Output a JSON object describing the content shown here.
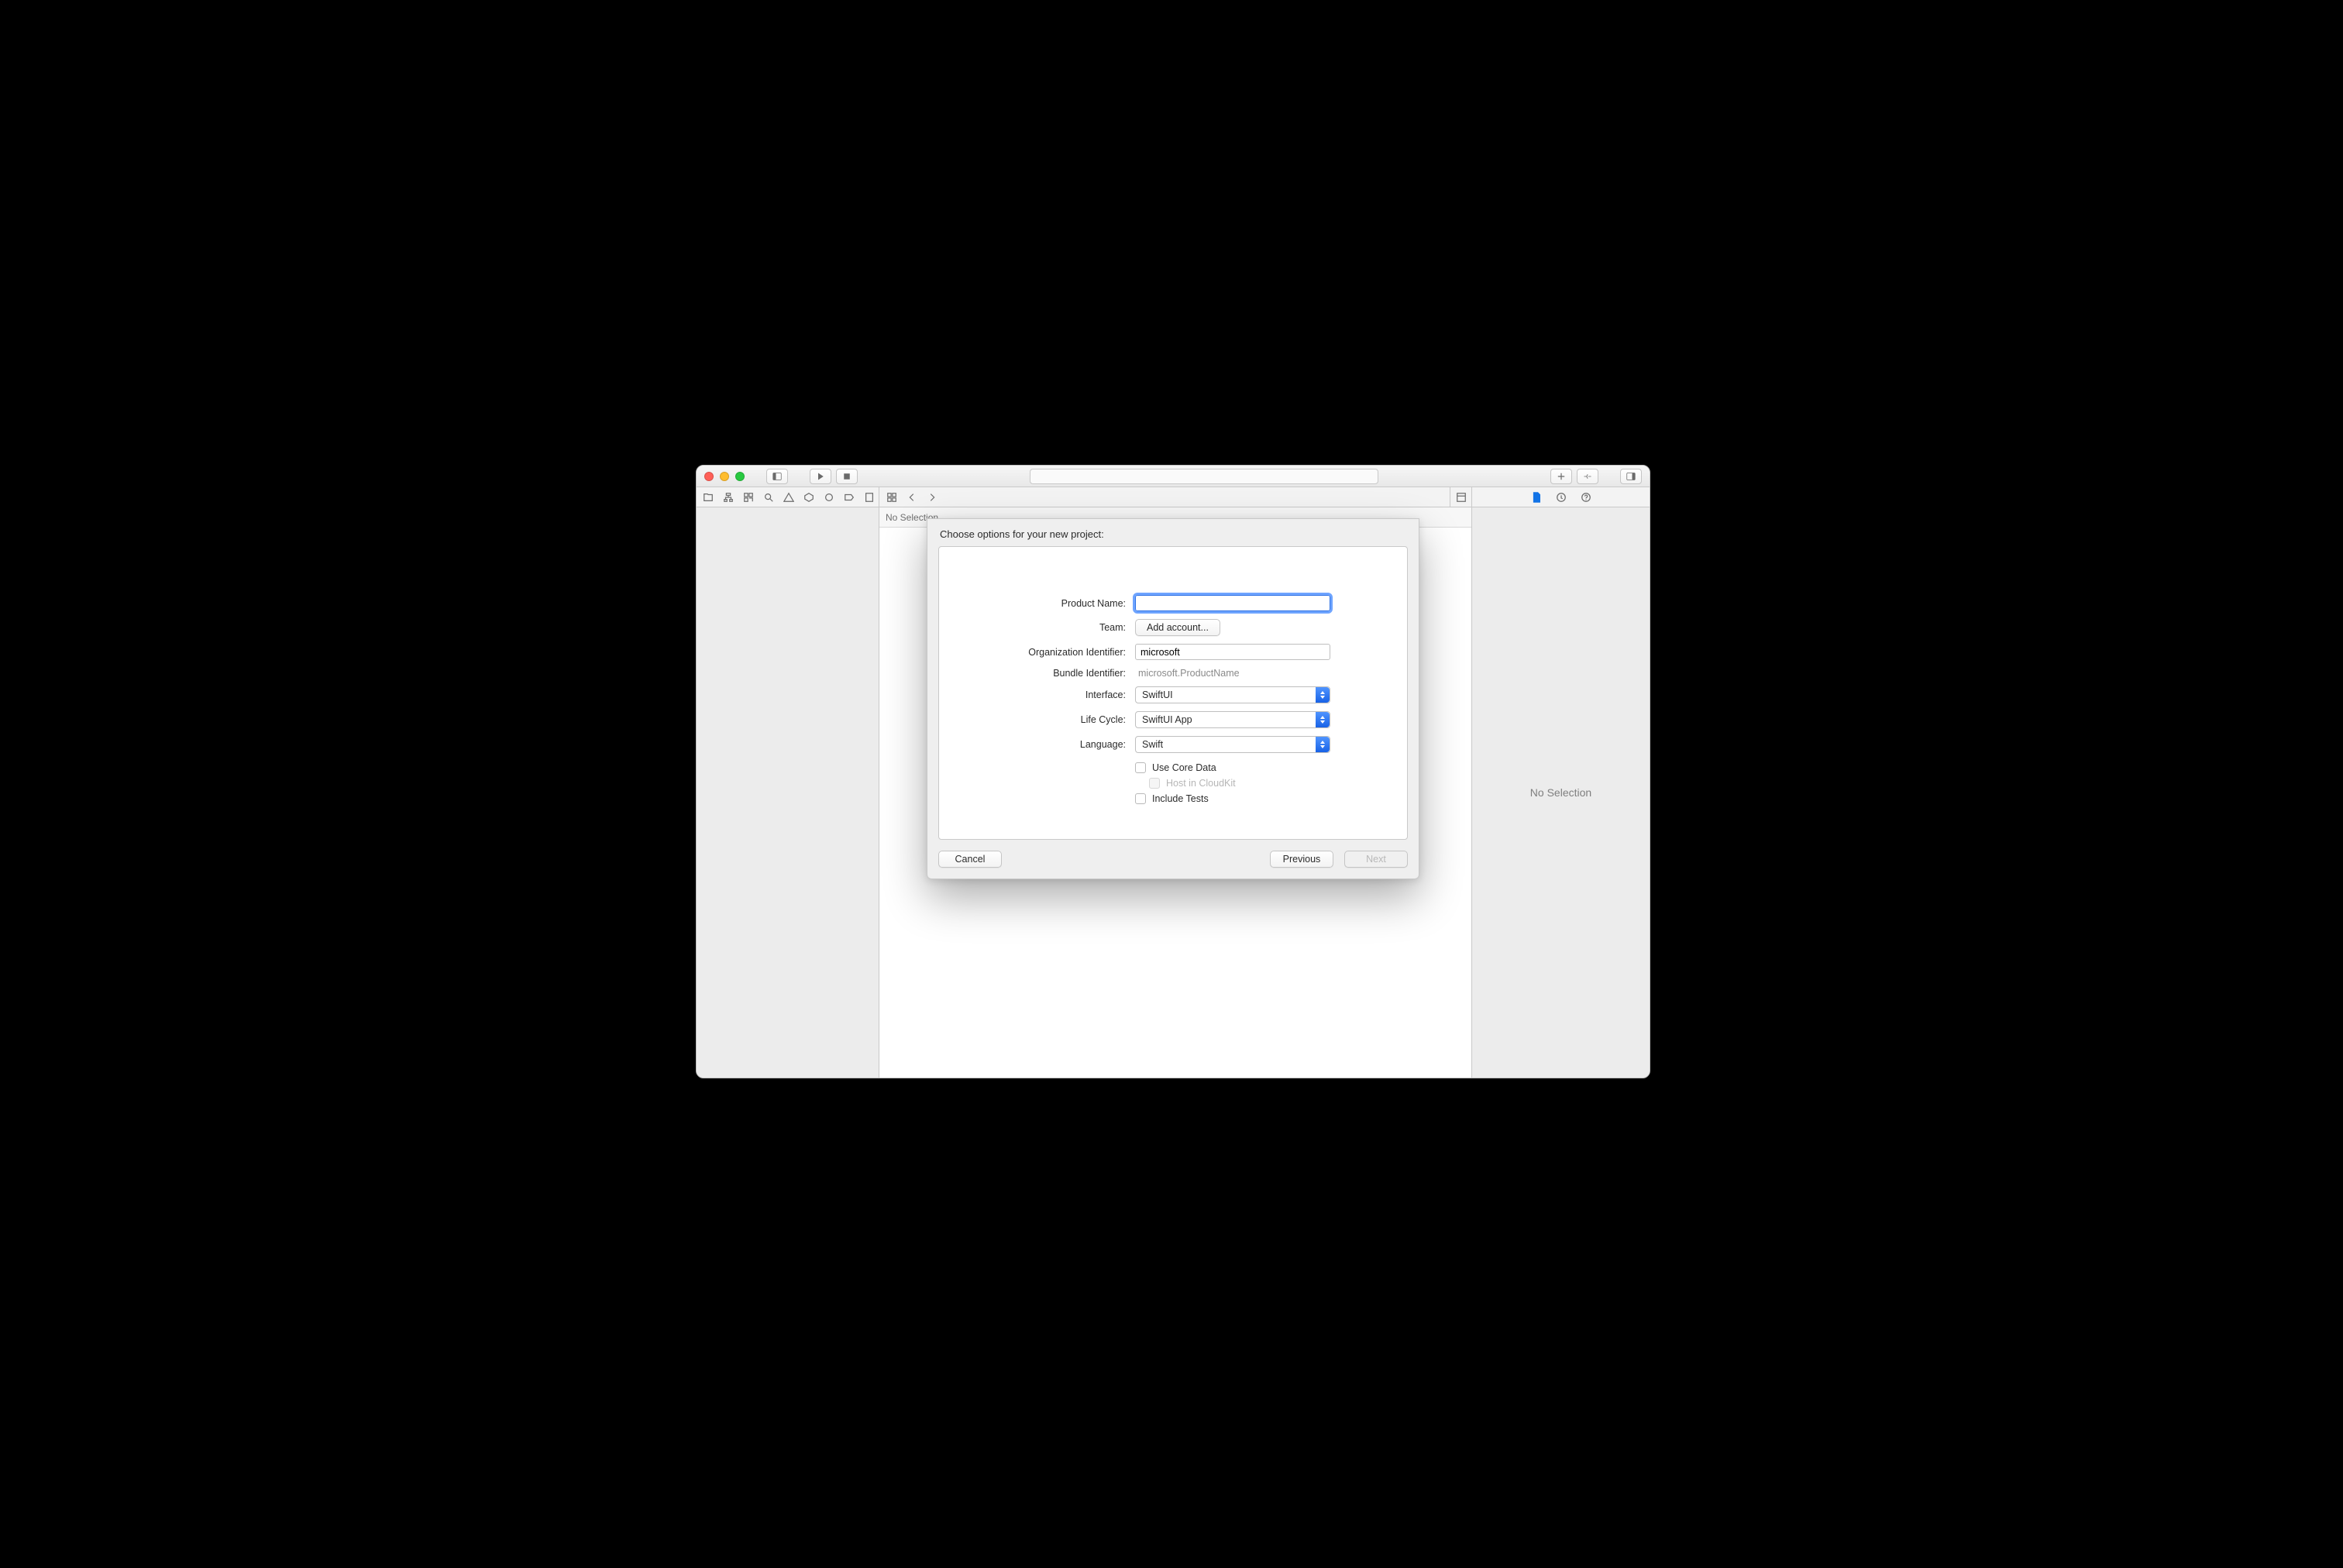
{
  "jumpbar": {
    "label": "No Selection"
  },
  "inspector": {
    "placeholder": "No Selection"
  },
  "sheet": {
    "title": "Choose options for your new project:",
    "labels": {
      "product_name": "Product Name:",
      "team": "Team:",
      "org_id": "Organization Identifier:",
      "bundle_id": "Bundle Identifier:",
      "interface": "Interface:",
      "life_cycle": "Life Cycle:",
      "language": "Language:"
    },
    "values": {
      "product_name": "",
      "team_button": "Add account...",
      "org_id": "microsoft",
      "bundle_id": "microsoft.ProductName",
      "interface": "SwiftUI",
      "life_cycle": "SwiftUI App",
      "language": "Swift"
    },
    "checks": {
      "core_data": "Use Core Data",
      "cloudkit": "Host in CloudKit",
      "tests": "Include Tests"
    },
    "buttons": {
      "cancel": "Cancel",
      "previous": "Previous",
      "next": "Next"
    }
  }
}
